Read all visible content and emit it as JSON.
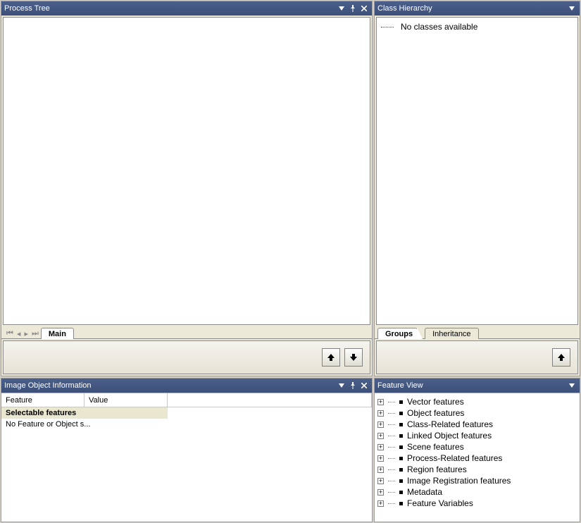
{
  "process_tree": {
    "title": "Process Tree",
    "tabs": [
      {
        "label": "Main",
        "active": true
      }
    ]
  },
  "class_hierarchy": {
    "title": "Class Hierarchy",
    "empty_text": "No classes available",
    "tabs": [
      {
        "label": "Groups",
        "active": true
      },
      {
        "label": "Inheritance",
        "active": false
      }
    ]
  },
  "image_object_info": {
    "title": "Image Object Information",
    "columns": {
      "feature": "Feature",
      "value": "Value"
    },
    "section_header": "Selectable features",
    "empty_msg": "No Feature or Object s..."
  },
  "feature_view": {
    "title": "Feature View",
    "items": [
      {
        "label": "Vector features"
      },
      {
        "label": "Object features"
      },
      {
        "label": "Class-Related features"
      },
      {
        "label": "Linked Object features"
      },
      {
        "label": "Scene features"
      },
      {
        "label": "Process-Related features"
      },
      {
        "label": "Region features"
      },
      {
        "label": "Image Registration features"
      },
      {
        "label": "Metadata"
      },
      {
        "label": "Feature Variables"
      }
    ]
  }
}
